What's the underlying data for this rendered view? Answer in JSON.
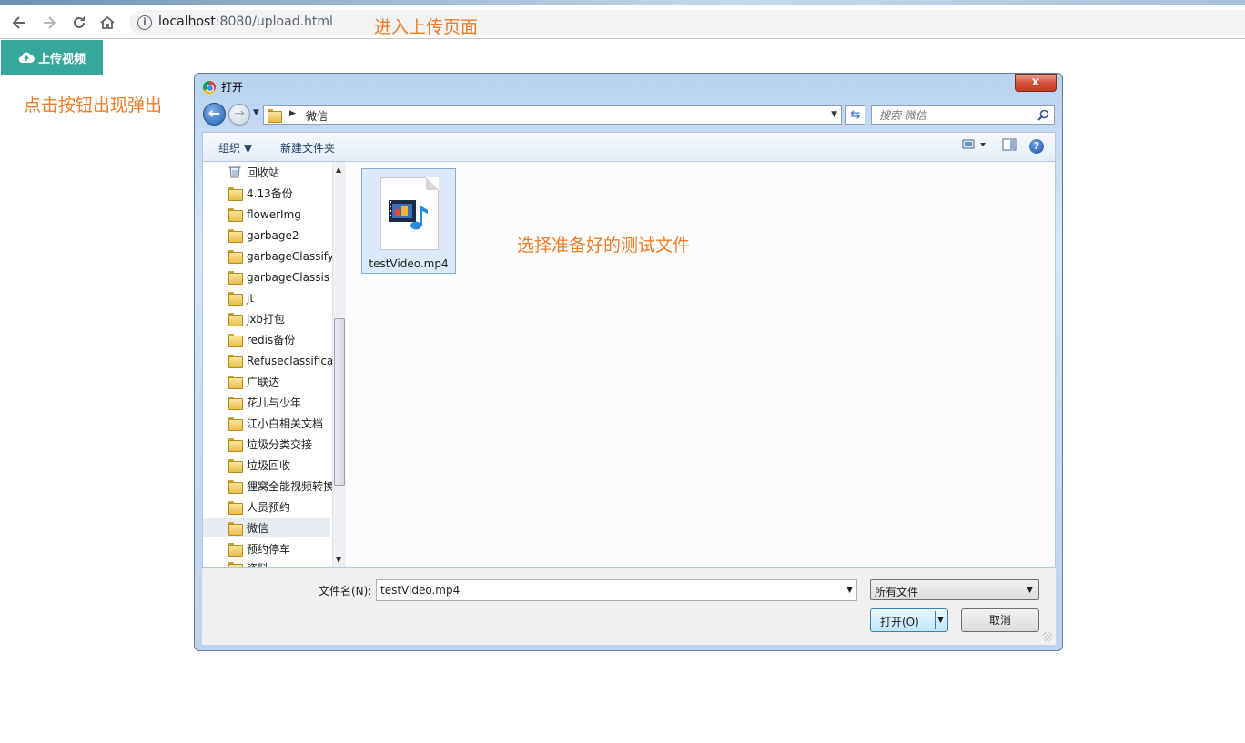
{
  "browser": {
    "url_host": "localhost",
    "url_path": ":8080/upload.html"
  },
  "annotations": {
    "enter_page": "进入上传页面",
    "click_button": "点击按钮出现弹出",
    "choose_file": "选择准备好的测试文件"
  },
  "page": {
    "upload_button": "上传视频"
  },
  "dialog": {
    "title": "打开",
    "close_label": "x",
    "breadcrumb": "微信",
    "search_placeholder": "搜索 微信",
    "organize": "组织 ▼",
    "new_folder": "新建文件夹",
    "nav_items": [
      "回收站",
      "4.13备份",
      "flowerImg",
      "garbage2",
      "garbageClassify",
      "garbageClassis",
      "jt",
      "jxb打包",
      "redis备份",
      "Refuseclassifica",
      "广联达",
      "花儿与少年",
      "江小白相关文档",
      "垃圾分类交接",
      "垃圾回收",
      "狸窝全能视频转换",
      "人员预约",
      "微信",
      "预约停车",
      "资料"
    ],
    "selected_nav": "微信",
    "file_name": "testVideo.mp4",
    "filename_label": "文件名(N):",
    "filename_value": "testVideo.mp4",
    "file_type": "所有文件",
    "open_button": "打开(O)",
    "cancel_button": "取消"
  },
  "colors": {
    "annotation": "#f07d26",
    "upload_button_bg": "#37a69b"
  }
}
